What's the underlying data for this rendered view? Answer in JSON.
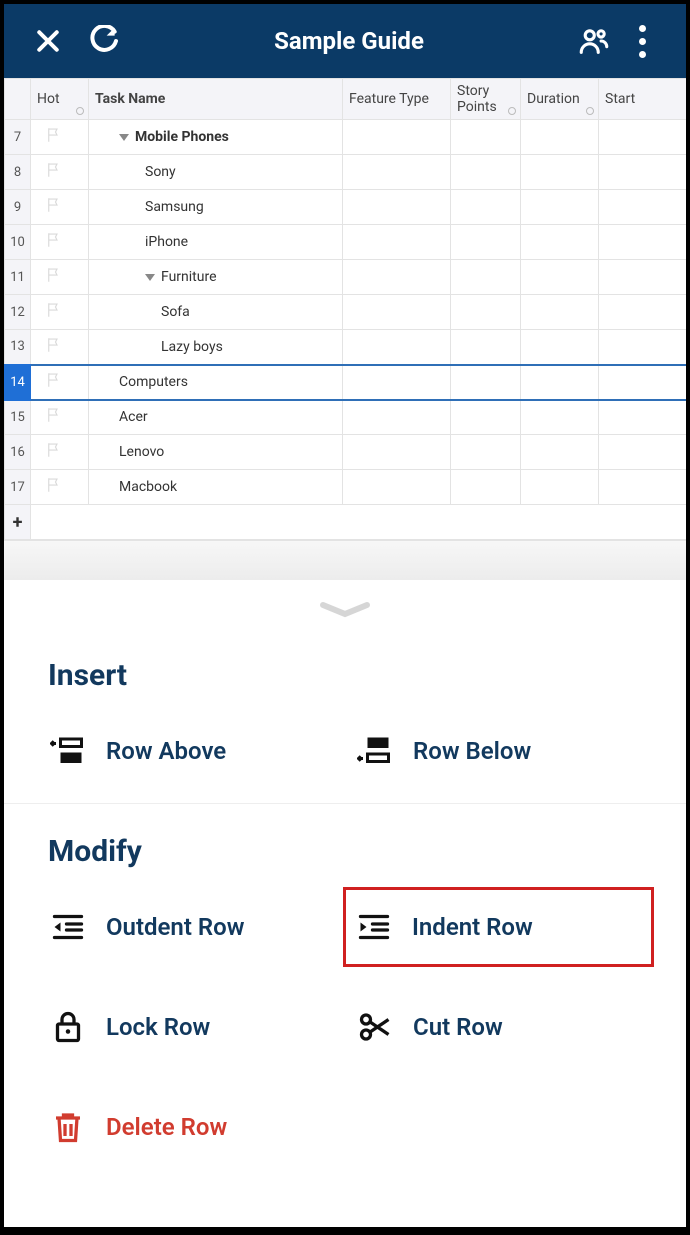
{
  "header": {
    "title": "Sample Guide"
  },
  "columns": {
    "hot": "Hot",
    "task": "Task Name",
    "feature": "Feature Type",
    "story": "Story Points",
    "duration": "Duration",
    "start": "Start"
  },
  "rows": [
    {
      "num": "7",
      "bold": true,
      "caret": true,
      "indent": 1,
      "task": "Mobile Phones",
      "selected": false
    },
    {
      "num": "8",
      "bold": false,
      "caret": false,
      "indent": 2,
      "task": "Sony",
      "selected": false
    },
    {
      "num": "9",
      "bold": false,
      "caret": false,
      "indent": 2,
      "task": "Samsung",
      "selected": false
    },
    {
      "num": "10",
      "bold": false,
      "caret": false,
      "indent": 2,
      "task": "iPhone",
      "selected": false
    },
    {
      "num": "11",
      "bold": false,
      "caret": true,
      "indent": 2,
      "task": "Furniture",
      "selected": false
    },
    {
      "num": "12",
      "bold": false,
      "caret": false,
      "indent": 3,
      "task": "Sofa",
      "selected": false
    },
    {
      "num": "13",
      "bold": false,
      "caret": false,
      "indent": 3,
      "task": "Lazy boys",
      "selected": false
    },
    {
      "num": "14",
      "bold": false,
      "caret": false,
      "indent": 1,
      "task": "Computers",
      "selected": true
    },
    {
      "num": "15",
      "bold": false,
      "caret": false,
      "indent": 1,
      "task": "Acer",
      "selected": false
    },
    {
      "num": "16",
      "bold": false,
      "caret": false,
      "indent": 1,
      "task": "Lenovo",
      "selected": false
    },
    {
      "num": "17",
      "bold": false,
      "caret": false,
      "indent": 1,
      "task": "Macbook",
      "selected": false
    }
  ],
  "addrow_label": "+",
  "actions": {
    "insert_title": "Insert",
    "row_above": "Row Above",
    "row_below": "Row Below",
    "modify_title": "Modify",
    "outdent": "Outdent Row",
    "indent": "Indent Row",
    "lock": "Lock Row",
    "cut": "Cut Row",
    "delete": "Delete Row"
  }
}
